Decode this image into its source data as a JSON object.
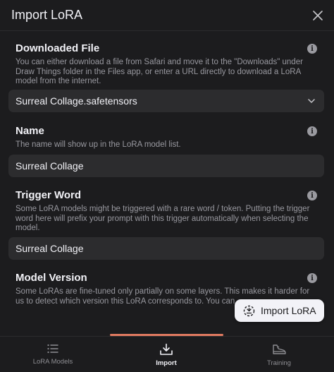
{
  "window": {
    "title": "Import LoRA"
  },
  "sections": {
    "downloaded_file": {
      "header": "Downloaded File",
      "desc": "You can either download a file from Safari and move it to the \"Downloads\" under Draw Things folder in the Files app, or enter a URL directly to download a LoRA model from the internet.",
      "value": "Surreal Collage.safetensors"
    },
    "name": {
      "header": "Name",
      "desc": "The name will show up in the LoRA model list.",
      "value": "Surreal Collage"
    },
    "trigger_word": {
      "header": "Trigger Word",
      "desc": "Some LoRA models might be triggered with a rare word / token. Putting the trigger word here will prefix your prompt with this trigger automatically when selecting the model.",
      "value": "Surreal Collage"
    },
    "model_version": {
      "header": "Model Version",
      "desc": "Some LoRAs are fine-tuned only partially on some layers. This makes it harder for us to detect which version this LoRA corresponds to. You can"
    }
  },
  "import_button": {
    "label": "Import LoRA"
  },
  "tabs": [
    {
      "label": "LoRA Models",
      "icon": "list-icon",
      "active": false
    },
    {
      "label": "Import",
      "icon": "download-tray-icon",
      "active": true
    },
    {
      "label": "Training",
      "icon": "sneaker-icon",
      "active": false
    }
  ],
  "colors": {
    "background": "#1c1c1e",
    "field": "#2c2c2e",
    "accent_indicator": "#e07a60",
    "secondary_text": "#98989f"
  }
}
